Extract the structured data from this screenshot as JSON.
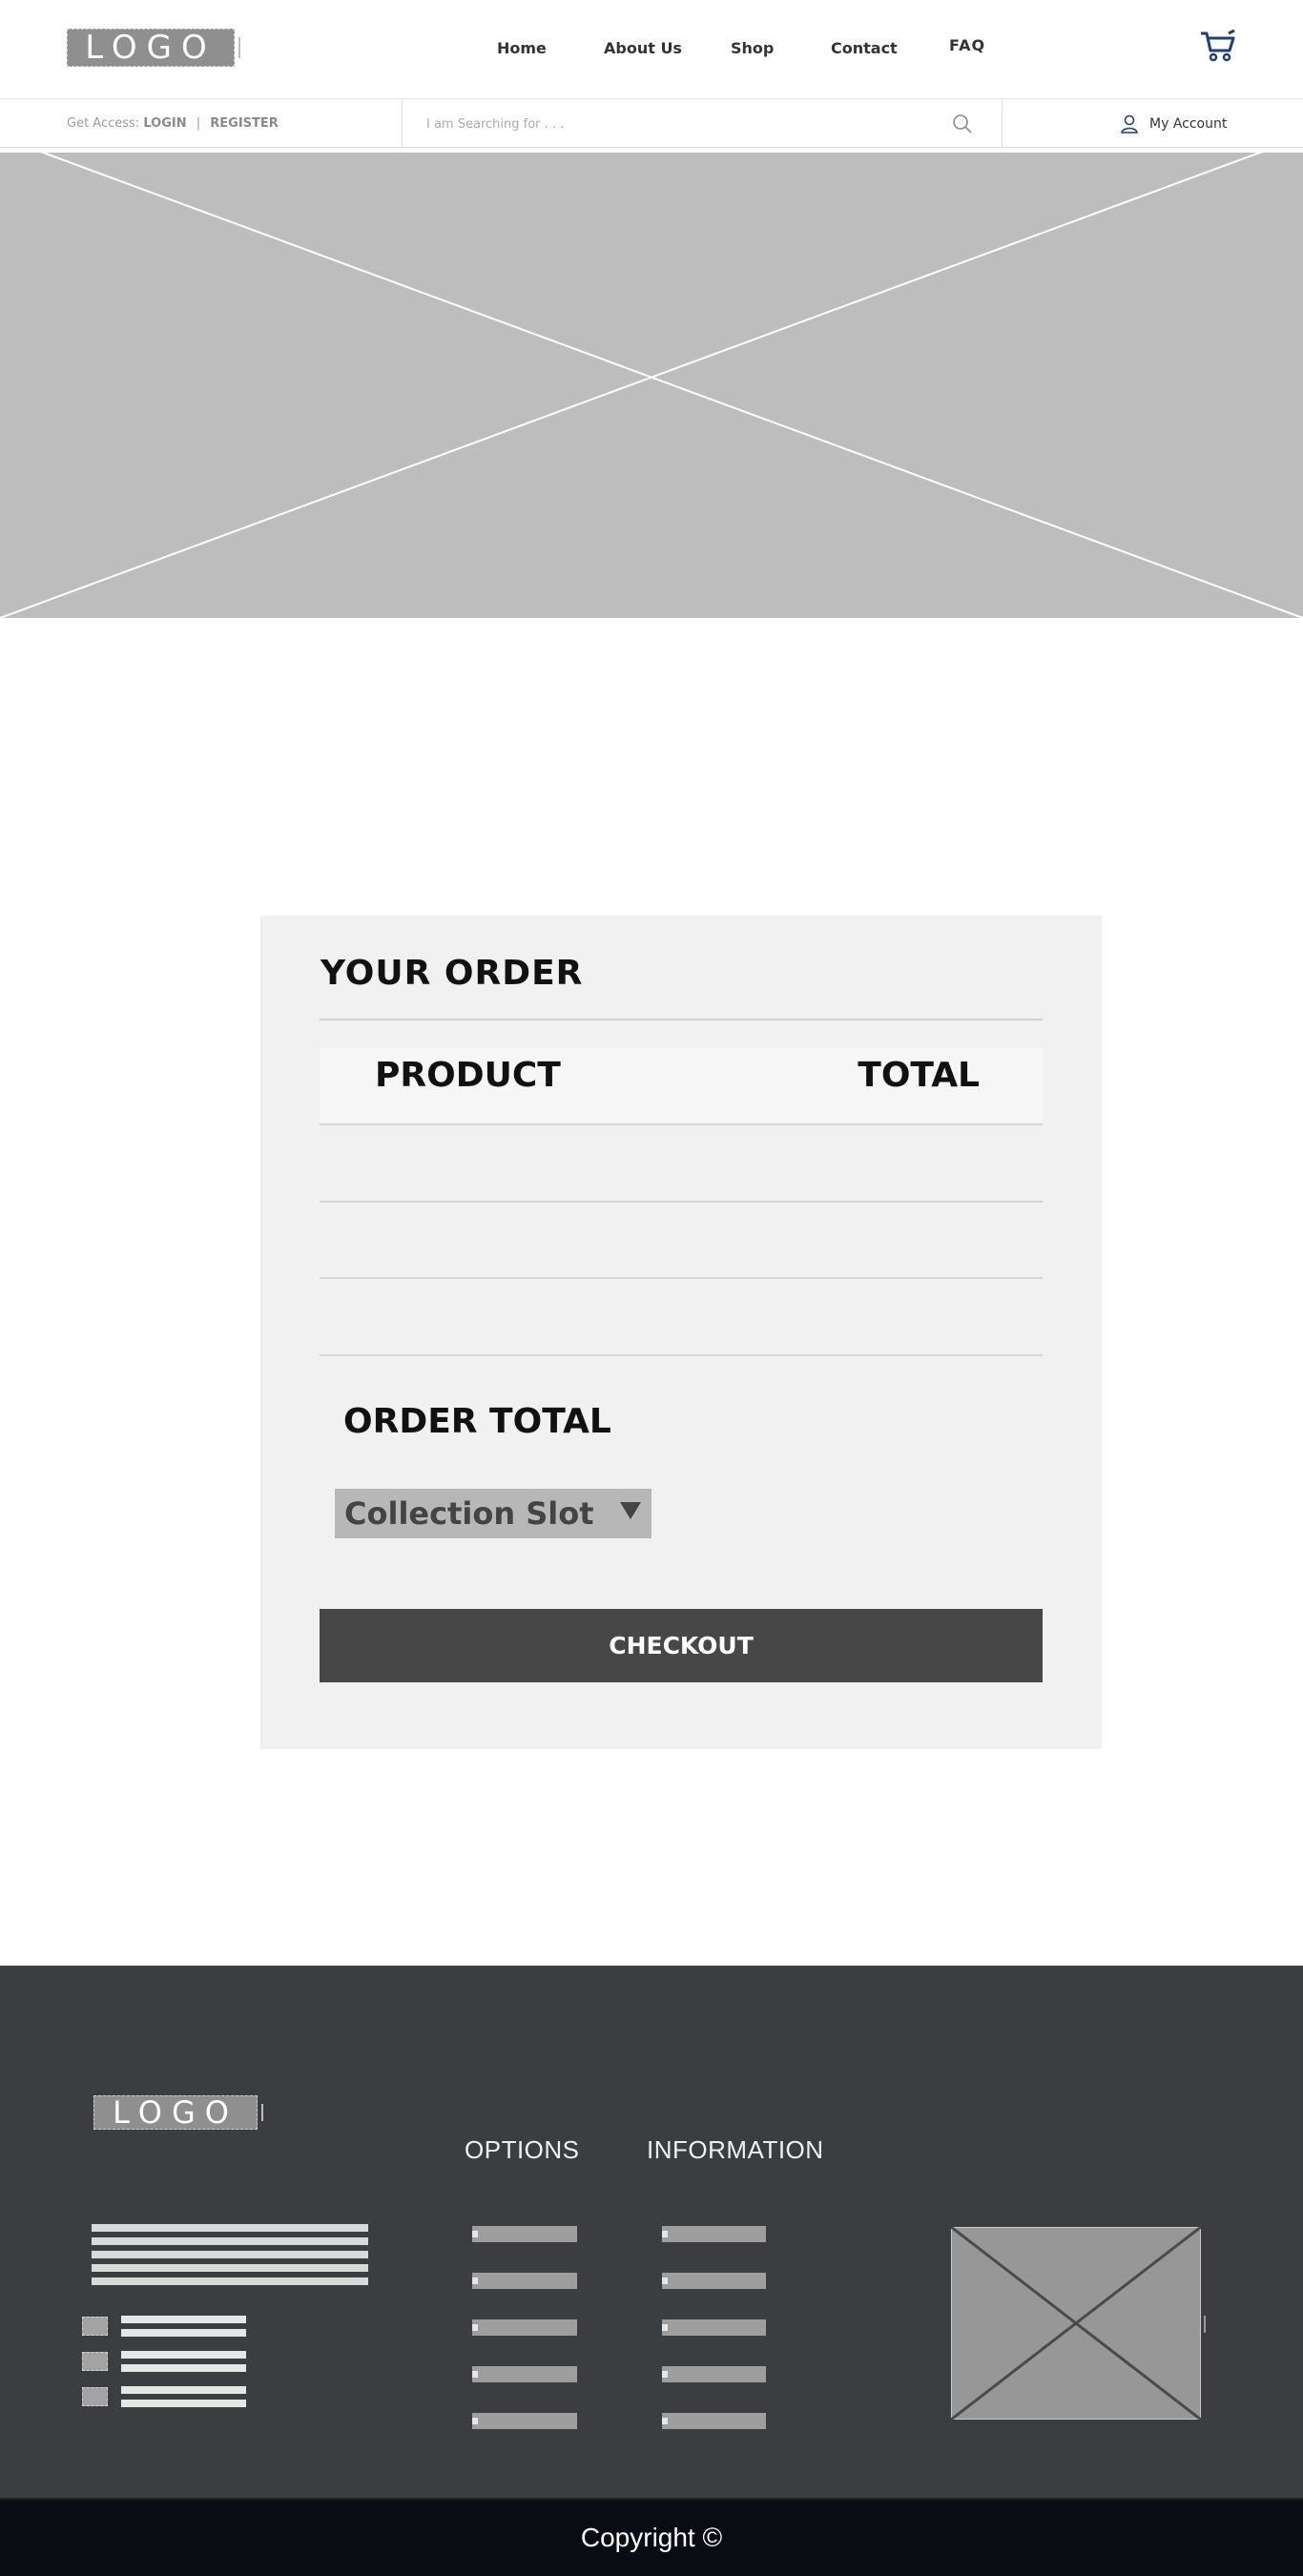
{
  "header": {
    "logo_text": "LOGO",
    "nav": [
      "Home",
      "About Us",
      "Shop",
      "Contact",
      "FAQ"
    ],
    "cart_icon": "cart-icon"
  },
  "subbar": {
    "access_prefix": "Get Access:",
    "login": "LOGIN",
    "separator": "|",
    "register": "REGISTER",
    "search_placeholder": "I am Searching for . . .",
    "account_label": "My Account"
  },
  "order": {
    "title": "YOUR ORDER",
    "col_product": "PRODUCT",
    "col_total": "TOTAL",
    "order_total_label": "ORDER TOTAL",
    "collection_slot": "Collection Slot",
    "checkout_label": "CHECKOUT"
  },
  "footer": {
    "logo_text": "LOGO",
    "options_heading": "OPTIONS",
    "information_heading": "INFORMATION",
    "copyright": "Copyright ©"
  },
  "colors": {
    "hero_placeholder": "#bdbdbd",
    "checkout_button": "#474747",
    "footer_bg": "#3b3d40",
    "copyright_bg": "#0b0c13"
  }
}
